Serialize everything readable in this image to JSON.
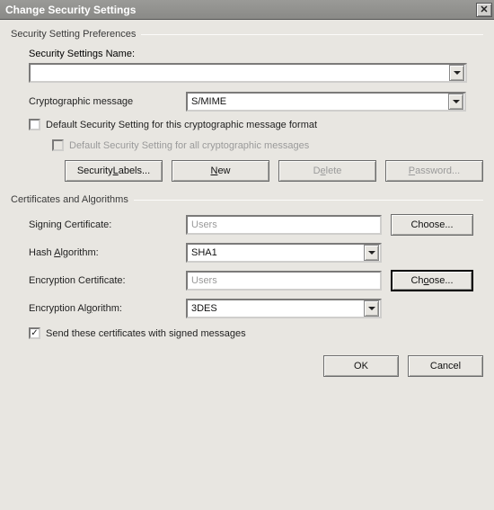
{
  "title": "Change Security Settings",
  "group1": {
    "legend": "Security Setting Preferences",
    "name_label": "Security Settings Name:",
    "name_value": "",
    "crypto_label": "Cryptographic message",
    "crypto_value": "S/MIME",
    "cb_default": "Default Security Setting for this cryptographic message format",
    "cb_default_all": "Default Security Setting for all cryptographic messages",
    "btn_labels": "Security Labels...",
    "btn_new": "New",
    "btn_delete": "Delete",
    "btn_password": "Password..."
  },
  "group2": {
    "legend": "Certificates and Algorithms",
    "signing_label": "Signing Certificate:",
    "signing_value": "Users",
    "hash_label": "Hash Algorithm:",
    "hash_value": "SHA1",
    "enc_cert_label": "Encryption Certificate:",
    "enc_cert_value": "Users",
    "enc_algo_label": "Encryption Algorithm:",
    "enc_algo_value": "3DES",
    "choose": "Choose...",
    "cb_send": "Send these certificates with signed messages"
  },
  "footer": {
    "ok": "OK",
    "cancel": "Cancel"
  }
}
